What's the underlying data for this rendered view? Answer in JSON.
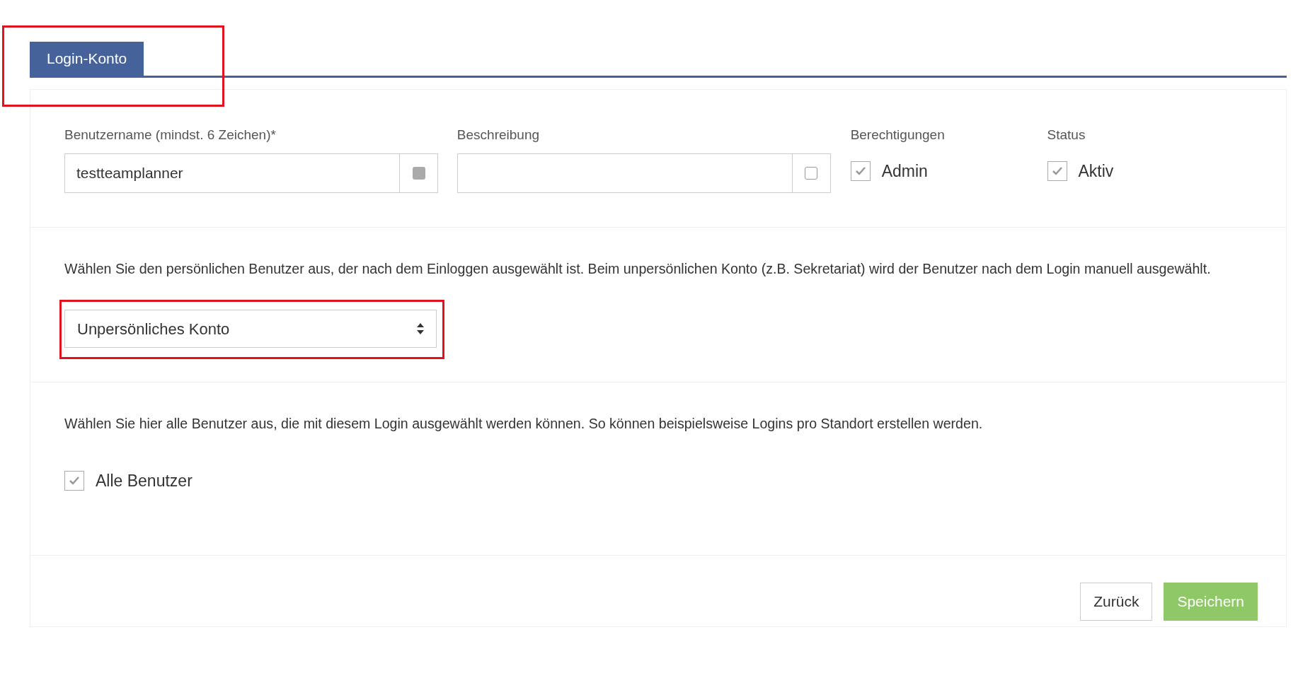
{
  "tabs": [
    {
      "label": "Login-Konto",
      "selected": true,
      "highlighted": true
    }
  ],
  "fields": [
    {
      "label": "Benutzername (mindst. 6 Zeichen)*",
      "value": "testteamplanner",
      "addon_filled": true
    },
    {
      "label": "Beschreibung",
      "addon_filled": false
    }
  ],
  "checkgroups": [
    {
      "label": "Berechtigungen",
      "option": "Admin",
      "checked": true
    },
    {
      "label": "Status",
      "option": "Aktiv",
      "checked": true
    }
  ],
  "personal_user": {
    "hint": "Wählen Sie den persönlichen Benutzer aus, der nach dem Einloggen ausgewählt ist. Beim unpersönlichen Konto (z.B. Sekretariat) wird der Benutzer nach dem Login manuell ausgewählt.",
    "select": "Unpersönliches Konto",
    "highlighted": true
  },
  "users": {
    "hint": "Wählen Sie hier alle Benutzer aus, die mit diesem Login ausgewählt werden können. So können beispielsweise Logins pro Standort erstellen werden.",
    "option": "Alle Benutzer",
    "checked": true
  },
  "buttons": [
    {
      "label": "Zurück",
      "kind": "secondary"
    },
    {
      "label": "Speichern",
      "kind": "primary"
    }
  ]
}
